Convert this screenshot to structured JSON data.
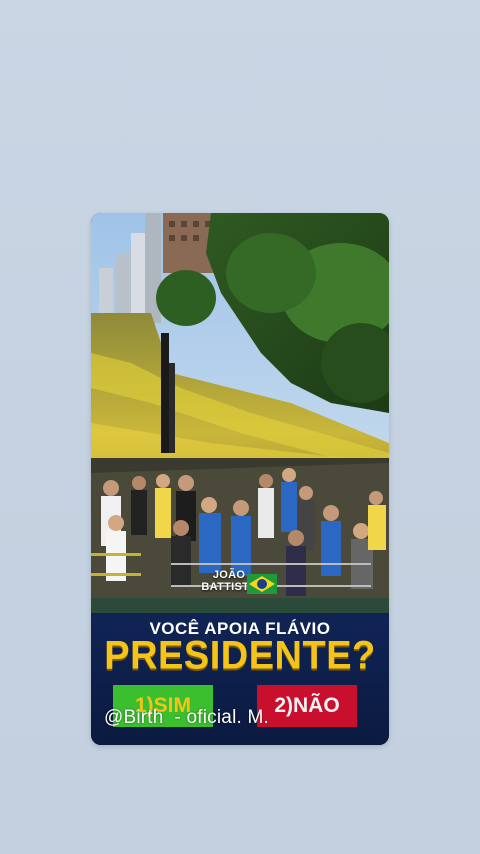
{
  "post": {
    "author": "JOÃO BATTISTA",
    "question": "VOCÊ APOIA FLÁVIO",
    "headline": "PRESIDENTE?",
    "option_yes": "1)SIM",
    "option_no": "2)NÃO"
  },
  "watermark": "@Birth  - oficial. M.",
  "icons": {
    "flag": "brazil-flag-icon"
  },
  "colors": {
    "background": "#c7d4e2",
    "headline": "#f6c418",
    "yes": "#3cbf2e",
    "no": "#c8102e",
    "panel": "#0d1a3a"
  }
}
